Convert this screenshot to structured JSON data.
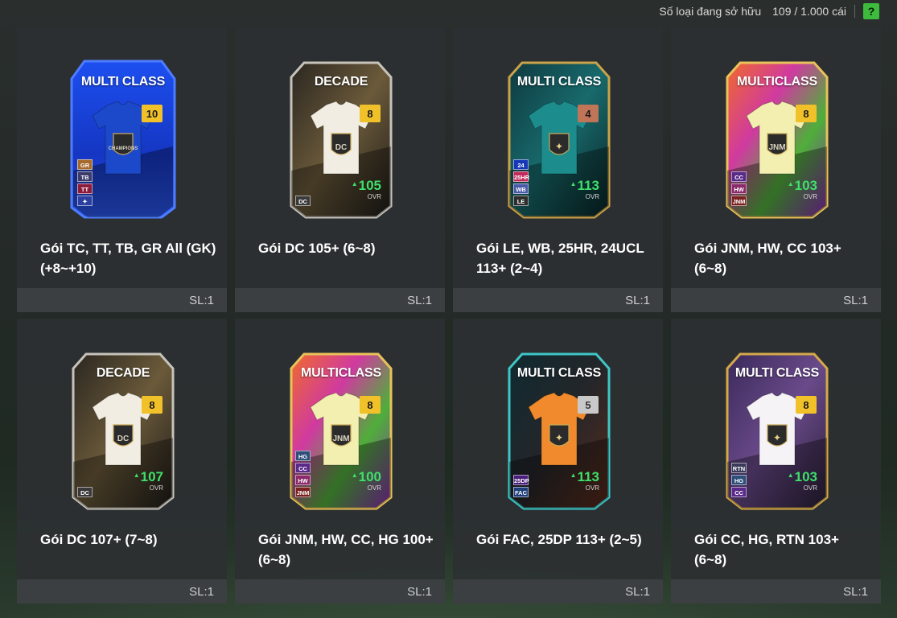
{
  "header": {
    "owned_label": "Số loại đang sở hữu",
    "owned_count": "109 / 1.000 cái",
    "help_label": "?"
  },
  "ovr_label": "OVR",
  "packs": [
    {
      "title": "Gói TC, TT, TB, GR All (GK) (+8~+10)",
      "qty": "SL:1",
      "card_title": "MULTI CLASS",
      "level": "10",
      "ovr": "",
      "badges": [
        "GR",
        "TB",
        "TT",
        "✦"
      ],
      "theme": "blue",
      "jersey": "#1c49c9",
      "level_color": "#f1c12a",
      "crest": "CHAMPIONS"
    },
    {
      "title": "Gói DC 105+ (6~8)",
      "qty": "SL:1",
      "card_title": "DECADE",
      "level": "8",
      "ovr": "105",
      "badges": [
        "DC"
      ],
      "theme": "decade",
      "jersey": "#f1ede2",
      "level_color": "#f1c12a",
      "crest": "DC"
    },
    {
      "title": "Gói LE, WB, 25HR, 24UCL 113+ (2~4)",
      "qty": "SL:1",
      "card_title": "MULTI CLASS",
      "level": "4",
      "ovr": "113",
      "badges": [
        "24",
        "25HR",
        "WB",
        "LE"
      ],
      "theme": "teal",
      "jersey": "#1d8c8c",
      "level_color": "#c07458",
      "crest": ""
    },
    {
      "title": "Gói JNM, HW, CC 103+ (6~8)",
      "qty": "SL:1",
      "card_title": "MULTICLASS",
      "level": "8",
      "ovr": "103",
      "badges": [
        "CC",
        "HW",
        "JNM"
      ],
      "theme": "rainbow",
      "jersey": "#f3efb0",
      "level_color": "#f1c12a",
      "crest": "JNM"
    },
    {
      "title": "Gói DC 107+ (7~8)",
      "qty": "SL:1",
      "card_title": "DECADE",
      "level": "8",
      "ovr": "107",
      "badges": [
        "DC"
      ],
      "theme": "decade",
      "jersey": "#f1ede2",
      "level_color": "#f1c12a",
      "crest": "DC"
    },
    {
      "title": "Gói JNM, HW, CC, HG 100+ (6~8)",
      "qty": "SL:1",
      "card_title": "MULTICLASS",
      "level": "8",
      "ovr": "100",
      "badges": [
        "HG",
        "CC",
        "HW",
        "JNM"
      ],
      "theme": "rainbow",
      "jersey": "#f3efb0",
      "level_color": "#f1c12a",
      "crest": "JNM"
    },
    {
      "title": "Gói FAC, 25DP 113+ (2~5)",
      "qty": "SL:1",
      "card_title": "MULTI CLASS",
      "level": "5",
      "ovr": "113",
      "badges": [
        "25DP",
        "FAC"
      ],
      "theme": "dark",
      "jersey": "#f08a2c",
      "level_color": "#c9c9c9",
      "crest": ""
    },
    {
      "title": "Gói CC, HG, RTN 103+ (6~8)",
      "qty": "SL:1",
      "card_title": "MULTI CLASS",
      "level": "8",
      "ovr": "103",
      "badges": [
        "RTN",
        "HG",
        "CC"
      ],
      "theme": "purple",
      "jersey": "#f5f3f6",
      "level_color": "#f1c12a",
      "crest": ""
    }
  ],
  "colors": {
    "accent_green": "#3ee06a",
    "help_green": "#3dbb3d",
    "tile_bg": "#2c3032",
    "footer_bg": "#3c4042"
  }
}
